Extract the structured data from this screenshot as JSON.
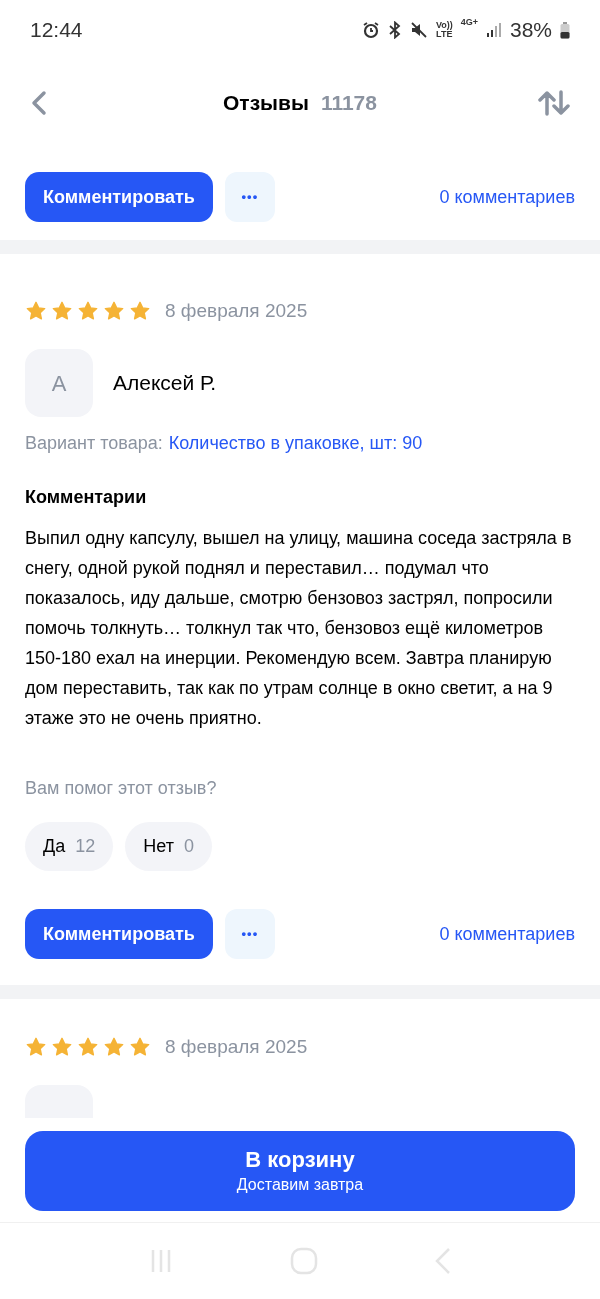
{
  "status_bar": {
    "time": "12:44",
    "volte_top": "Vo))",
    "volte_bottom": "LTE",
    "network": "4G+",
    "battery": "38%"
  },
  "header": {
    "title": "Отзывы",
    "count": "11178"
  },
  "top_actions": {
    "comment_button": "Комментировать",
    "more": "•••",
    "comments_count": "0 комментариев"
  },
  "reviews": [
    {
      "stars": 5,
      "date": "8 февраля 2025",
      "avatar_letter": "А",
      "author": "Алексей Р.",
      "variant_label": "Вариант товара:",
      "variant_value": "Количество в упаковке, шт: 90",
      "section_title": "Комментарии",
      "text": "Выпил одну капсулу, вышел на улицу, машина соседа застряла в снегу, одной рукой поднял и переставил… подумал что показалось, иду дальше, смотрю бензовоз застрял, попросили помочь толкнуть… толкнул так что, бензовоз ещё километров 150-180 ехал на инерции. Рекомендую всем. Завтра планирую дом переставить, так как по утрам солнце в окно светит, а на 9 этаже это не очень приятно.",
      "helpful_question": "Вам помог этот отзыв?",
      "votes": [
        {
          "label": "Да",
          "count": "12"
        },
        {
          "label": "Нет",
          "count": "0"
        }
      ],
      "comment_button": "Комментировать",
      "more": "•••",
      "comments_count": "0 комментариев"
    },
    {
      "stars": 5,
      "date": "8 февраля 2025"
    }
  ],
  "cart_button": {
    "title": "В корзину",
    "subtitle": "Доставим завтра"
  }
}
